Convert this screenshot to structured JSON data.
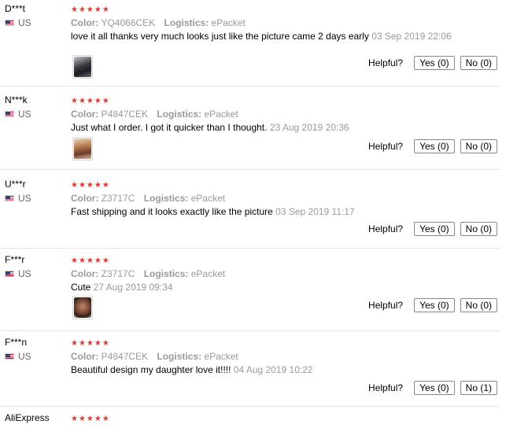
{
  "reviews": [
    {
      "name": "D***t",
      "country": "US",
      "stars": "★★★★★",
      "color_label": "Color:",
      "color_value": "YQ4066CEK",
      "logistics_label": "Logistics:",
      "logistics_value": "ePacket",
      "text": "love it all thanks very much looks just like the picture came 2 days early",
      "date": "03 Sep 2019 22:06",
      "helpful_label": "Helpful?",
      "yes": "Yes (0)",
      "no": "No (0)"
    },
    {
      "name": "N***k",
      "country": "US",
      "stars": "★★★★★",
      "color_label": "Color:",
      "color_value": "P4847CEK",
      "logistics_label": "Logistics:",
      "logistics_value": "ePacket",
      "text": "Just what I order. I got it quicker than I thought.",
      "date": "23 Aug 2019 20:36",
      "helpful_label": "Helpful?",
      "yes": "Yes (0)",
      "no": "No (0)"
    },
    {
      "name": "U***r",
      "country": "US",
      "stars": "★★★★★",
      "color_label": "Color:",
      "color_value": "Z3717C",
      "logistics_label": "Logistics:",
      "logistics_value": "ePacket",
      "text": "Fast shipping and it looks exactly like the picture",
      "date": "03 Sep 2019 11:17",
      "helpful_label": "Helpful?",
      "yes": "Yes (0)",
      "no": "No (0)"
    },
    {
      "name": "F***r",
      "country": "US",
      "stars": "★★★★★",
      "color_label": "Color:",
      "color_value": "Z3717C",
      "logistics_label": "Logistics:",
      "logistics_value": "ePacket",
      "text": "Cute",
      "date": "27 Aug 2019 09:34",
      "helpful_label": "Helpful?",
      "yes": "Yes (0)",
      "no": "No (0)"
    },
    {
      "name": "F***n",
      "country": "US",
      "stars": "★★★★★",
      "color_label": "Color:",
      "color_value": "P4847CEK",
      "logistics_label": "Logistics:",
      "logistics_value": "ePacket",
      "text": "Beautiful design my daughter love it!!!!",
      "date": "04 Aug 2019 10:22",
      "helpful_label": "Helpful?",
      "yes": "Yes (0)",
      "no": "No (1)"
    },
    {
      "name": "AliExpress",
      "stars": "★★★★★"
    }
  ],
  "colors": {
    "star": "#e1382f",
    "meta_text": "#999999",
    "divider": "#e6e6e6"
  }
}
